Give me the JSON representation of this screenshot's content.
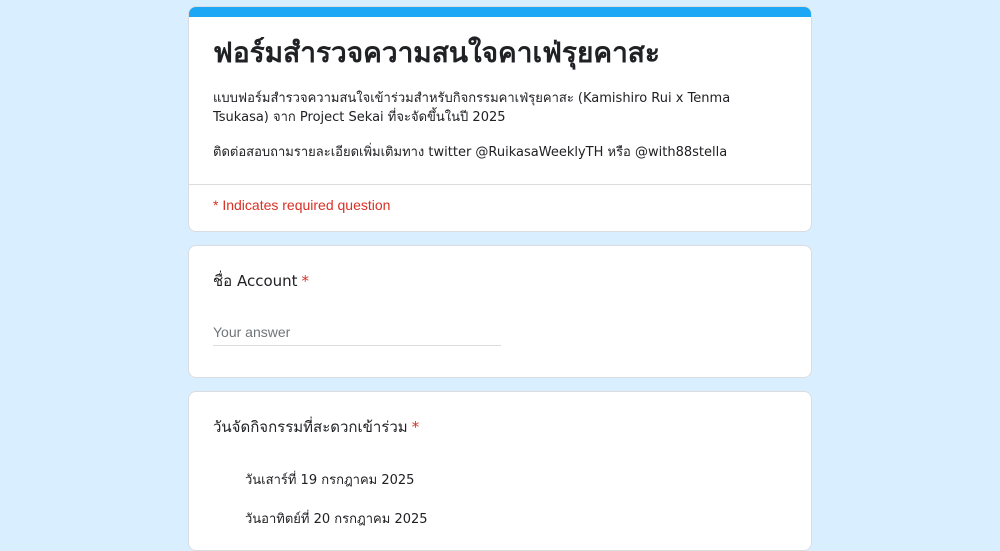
{
  "form": {
    "title": "ฟอร์มสำรวจความสนใจคาเฟ่รุยคาสะ",
    "description_line1": "แบบฟอร์มสำรวจความสนใจเข้าร่วมสำหรับกิจกรรมคาเฟ่รุยคาสะ (Kamishiro Rui x Tenma Tsukasa) จาก Project Sekai ที่จะจัดขึ้นในปี 2025",
    "description_line2": "ติดต่อสอบถามรายละเอียดเพิ่มเติมทาง twitter @RuikasaWeeklyTH หรือ @with88stella",
    "required_note": "* Indicates required question",
    "accent_color": "#1ea7f5",
    "background_color": "#d9efff",
    "required_color": "#d93025"
  },
  "questions": [
    {
      "title": "ชื่อ Account",
      "required_mark": "*",
      "answer_placeholder": "Your answer"
    },
    {
      "title": "วันจัดกิจกรรมที่สะดวกเข้าร่วม",
      "required_mark": "*",
      "options": [
        "วันเสาร์ที่ 19 กรกฎาคม 2025",
        "วันอาทิตย์ที่ 20 กรกฎาคม 2025"
      ]
    }
  ]
}
